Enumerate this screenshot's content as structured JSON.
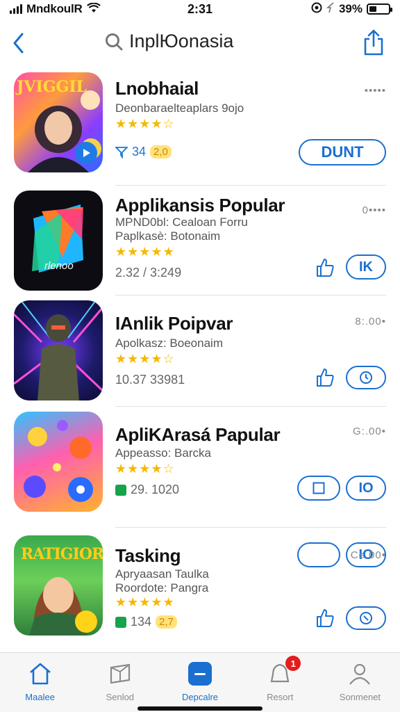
{
  "status_bar": {
    "carrier": "MndkoulR",
    "time": "2:31",
    "battery": "39%",
    "battery_level": 0.39
  },
  "nav": {
    "title": "InplЮonasia"
  },
  "apps": [
    {
      "name": "Lnobhaial",
      "subtitle": [
        "Deonbaraelteaplars 9ojo"
      ],
      "stars": "★★★★☆",
      "meta_value": "34",
      "meta_badge": "2,0",
      "more": "•••••",
      "action_label": "DUNT"
    },
    {
      "name": "Applikansis Popular",
      "subtitle": [
        "MPND0bl: Cealoan Forru",
        "Paplkasè: Botonaim"
      ],
      "stars": "★★★★★",
      "meta_value": "2.32 / 3:249",
      "more": "0••••",
      "action_label": "IΚ"
    },
    {
      "name": "IAnlik Poipvar",
      "subtitle": [
        "Apolkasz: Boeonaim"
      ],
      "stars": "★★★★☆",
      "meta_value": "10.37 33981",
      "more": "8:.00•",
      "action_label": ""
    },
    {
      "name": "ApliKArasá Papular",
      "subtitle": [
        "Appeasso: Barcka"
      ],
      "stars": "★★★★☆",
      "meta_value": "29. 1020",
      "more": "G:.00•",
      "action_label": "IO"
    },
    {
      "name": "Tasking",
      "subtitle": [
        "Apryaasan Taulka",
        "Roordote: Pangra"
      ],
      "stars": "★★★★★",
      "meta_value": "134",
      "meta_badge": "2,7",
      "more": "Ce.00•",
      "action_label": ""
    }
  ],
  "icon_labels": {
    "app1": "JVIGGIL",
    "app2": "rlenoo",
    "app5": "RATIGIOR"
  },
  "tabs": [
    {
      "label": "Maalee",
      "icon": "home-icon"
    },
    {
      "label": "Senlod",
      "icon": "box-icon"
    },
    {
      "label": "Depcalre",
      "icon": "square-minus-icon"
    },
    {
      "label": "Resort",
      "icon": "bell-icon",
      "badge": "1"
    },
    {
      "label": "Sonmenet",
      "icon": "person-icon"
    }
  ],
  "colors": {
    "accent": "#1a6fd0",
    "star": "#f5b800",
    "badge_red": "#e11d1d"
  }
}
